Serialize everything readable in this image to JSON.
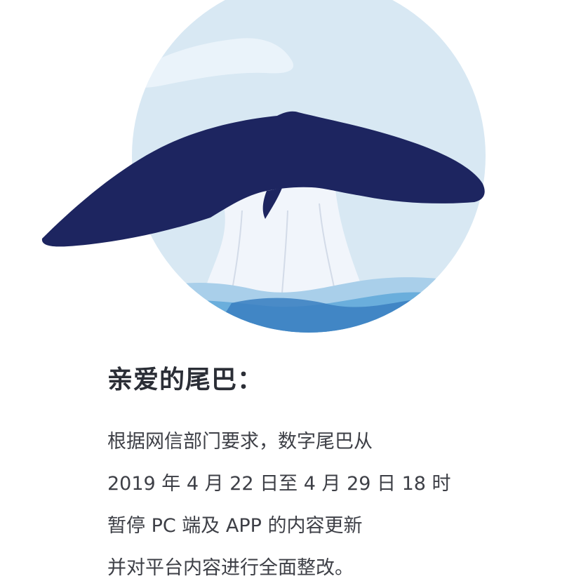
{
  "greeting": "亲爱的尾巴：",
  "message": {
    "lines": [
      "根据网信部门要求，数字尾巴从",
      "2019 年 4 月 22 日至 4 月 29 日 18 时",
      "暂停 PC 端及 APP 的内容更新",
      "并对平台内容进行全面整改。"
    ]
  },
  "illustration": {
    "subject": "whale-tail",
    "colors": {
      "sky": "#d8e8f3",
      "cloud": "#eaf3fa",
      "tail": "#1d2560",
      "splash": "#f1f5fb",
      "wave_light": "#a9cfea",
      "wave_mid": "#6aaedc",
      "wave_dark": "#3a7fc1"
    }
  }
}
